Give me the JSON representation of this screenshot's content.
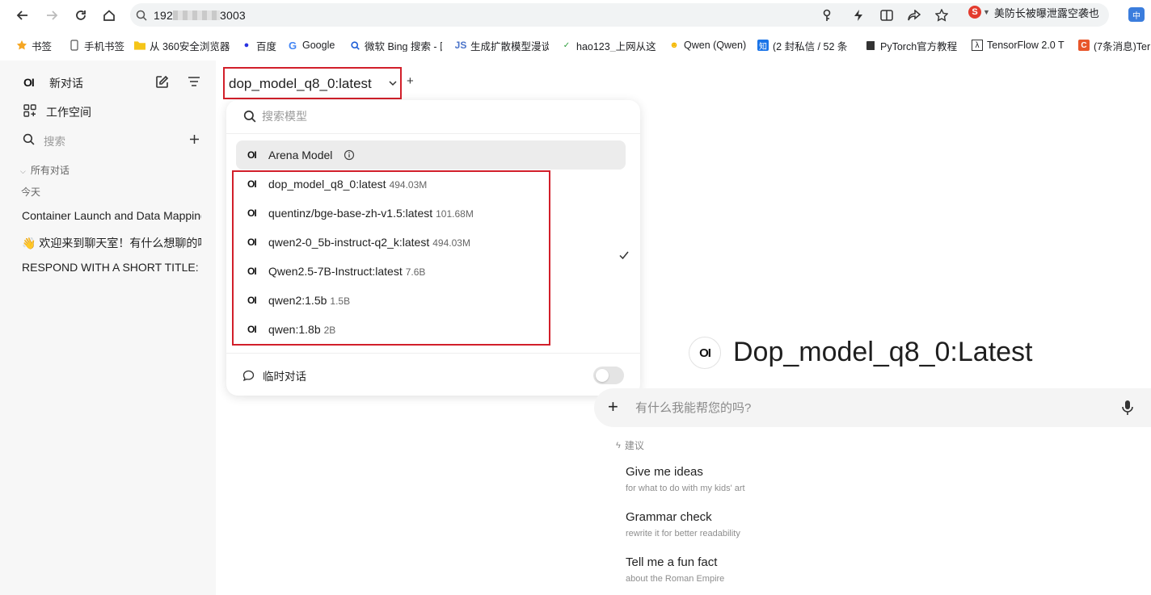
{
  "browser": {
    "url_start": "192",
    "url_end": "3003",
    "news_ticker": "美防长被曝泄露空袭也",
    "extension_label": "中",
    "bookmarks": [
      {
        "label": "书签",
        "icon": "star-icon"
      },
      {
        "label": "手机书签",
        "icon": "phone-icon"
      },
      {
        "label": "从 360安全浏览器",
        "icon": "folder-icon"
      },
      {
        "label": "百度",
        "icon": "baidu-paw-icon"
      },
      {
        "label": "Google",
        "icon": "google-g-icon"
      },
      {
        "label": "微软 Bing 搜索 - 国",
        "icon": "bing-search-icon"
      },
      {
        "label": "生成扩散模型漫谈",
        "icon": "js-logo-icon"
      },
      {
        "label": "hao123_上网从这",
        "icon": "hao123-icon"
      },
      {
        "label": "Qwen (Qwen)",
        "icon": "emoji-face-icon"
      },
      {
        "label": "(2 封私信 / 52 条",
        "icon": "zhihu-icon"
      },
      {
        "label": "PyTorch官方教程",
        "icon": "book-icon"
      },
      {
        "label": "TensorFlow 2.0 T",
        "icon": "lambda-icon"
      },
      {
        "label": "(7条消息)Ter",
        "icon": "csdn-icon"
      }
    ]
  },
  "sidebar": {
    "brand": "OI",
    "new_chat": "新对话",
    "workspace": "工作空间",
    "search_placeholder": "搜索",
    "all_chats": "所有对话",
    "today": "今天",
    "chats": [
      "Container Launch and Data Mapping",
      "👋 欢迎来到聊天室！有什么想聊的吗",
      "RESPOND WITH A SHORT TITLE:"
    ]
  },
  "model_selector": {
    "selected": "dop_model_q8_0:latest",
    "add": "+"
  },
  "dropdown": {
    "search_placeholder": "搜索模型",
    "arena": "Arena Model",
    "items": [
      {
        "name": "dop_model_q8_0:latest",
        "size": "494.03M",
        "selected": true
      },
      {
        "name": "quentinz/bge-base-zh-v1.5:latest",
        "size": "101.68M"
      },
      {
        "name": "qwen2-0_5b-instruct-q2_k:latest",
        "size": "494.03M"
      },
      {
        "name": "Qwen2.5-7B-Instruct:latest",
        "size": "7.6B"
      },
      {
        "name": "qwen2:1.5b",
        "size": "1.5B"
      },
      {
        "name": "qwen:1.8b",
        "size": "2B"
      }
    ],
    "temp_chat": "临时对话",
    "temp_chat_enabled": false
  },
  "main": {
    "model_title": "Dop_model_q8_0:Latest",
    "input_placeholder": "有什么我能帮您的吗?",
    "suggestions_label": "建议",
    "suggestions": [
      {
        "title": "Give me ideas",
        "subtitle": "for what to do with my kids' art"
      },
      {
        "title": "Grammar check",
        "subtitle": "rewrite it for better readability"
      },
      {
        "title": "Tell me a fun fact",
        "subtitle": "about the Roman Empire"
      }
    ]
  }
}
